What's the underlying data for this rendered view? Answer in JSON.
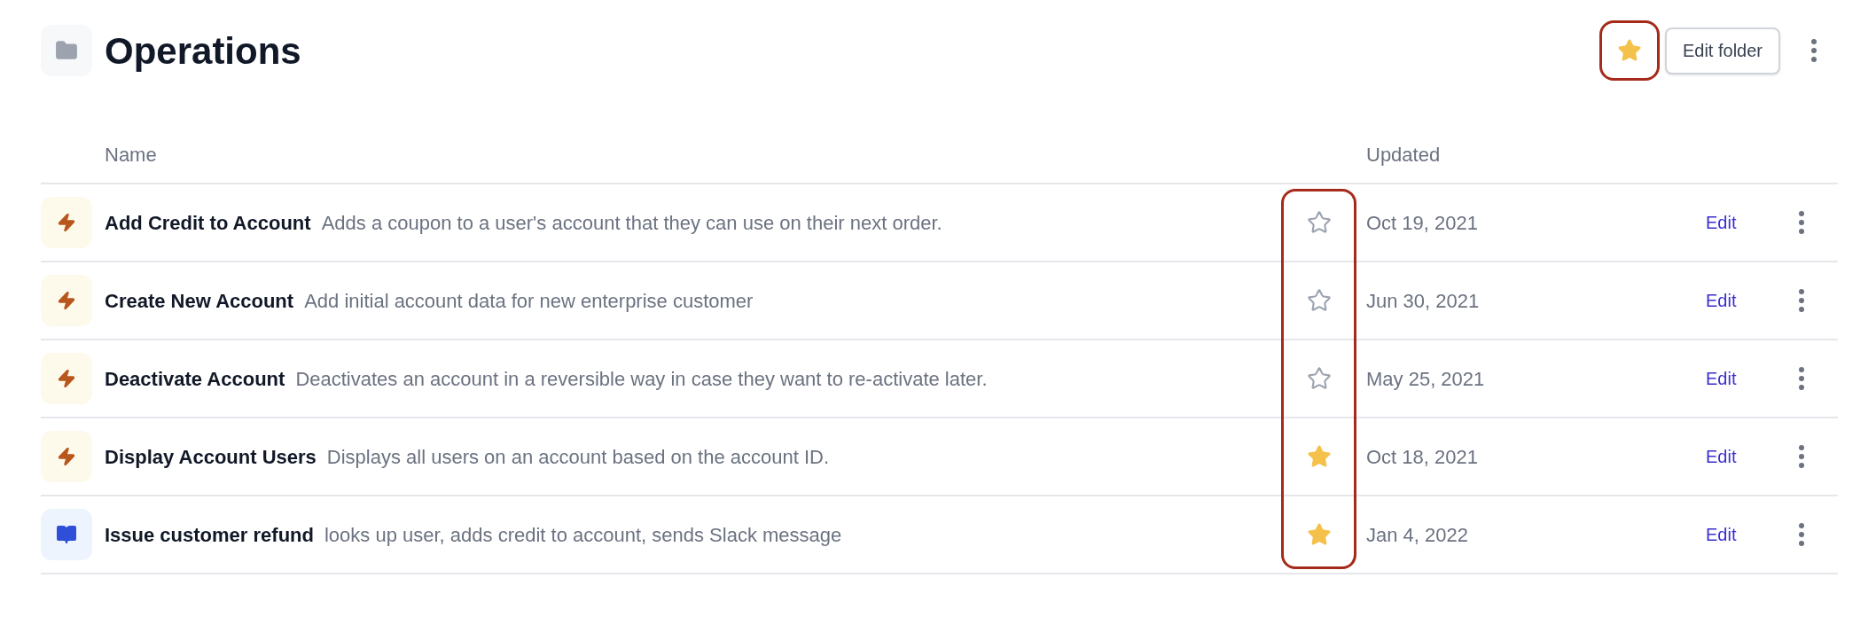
{
  "folder": {
    "title": "Operations",
    "favorite": true,
    "favorite_highlighted": true,
    "edit_button": "Edit folder"
  },
  "table": {
    "columns": [
      "Name",
      "Updated"
    ],
    "star_column_highlighted": true,
    "rows": [
      {
        "kind": "workflow",
        "name": "Add Credit to Account",
        "description": "Adds a coupon to a user's account that they can use on their next order.",
        "starred": false,
        "updated": "Oct 19, 2021",
        "action": "Edit"
      },
      {
        "kind": "workflow",
        "name": "Create New Account",
        "description": "Add initial account data for new enterprise customer",
        "starred": false,
        "updated": "Jun 30, 2021",
        "action": "Edit"
      },
      {
        "kind": "workflow",
        "name": "Deactivate Account",
        "description": "Deactivates an account in a reversible way in case they want to re-activate later.",
        "starred": false,
        "updated": "May 25, 2021",
        "action": "Edit"
      },
      {
        "kind": "workflow",
        "name": "Display Account Users",
        "description": "Displays all users on an account based on the account ID.",
        "starred": true,
        "updated": "Oct 18, 2021",
        "action": "Edit"
      },
      {
        "kind": "playbook",
        "name": "Issue customer refund",
        "description": "looks up user, adds credit to account, sends Slack message",
        "starred": true,
        "updated": "Jan 4, 2022",
        "action": "Edit"
      }
    ]
  }
}
